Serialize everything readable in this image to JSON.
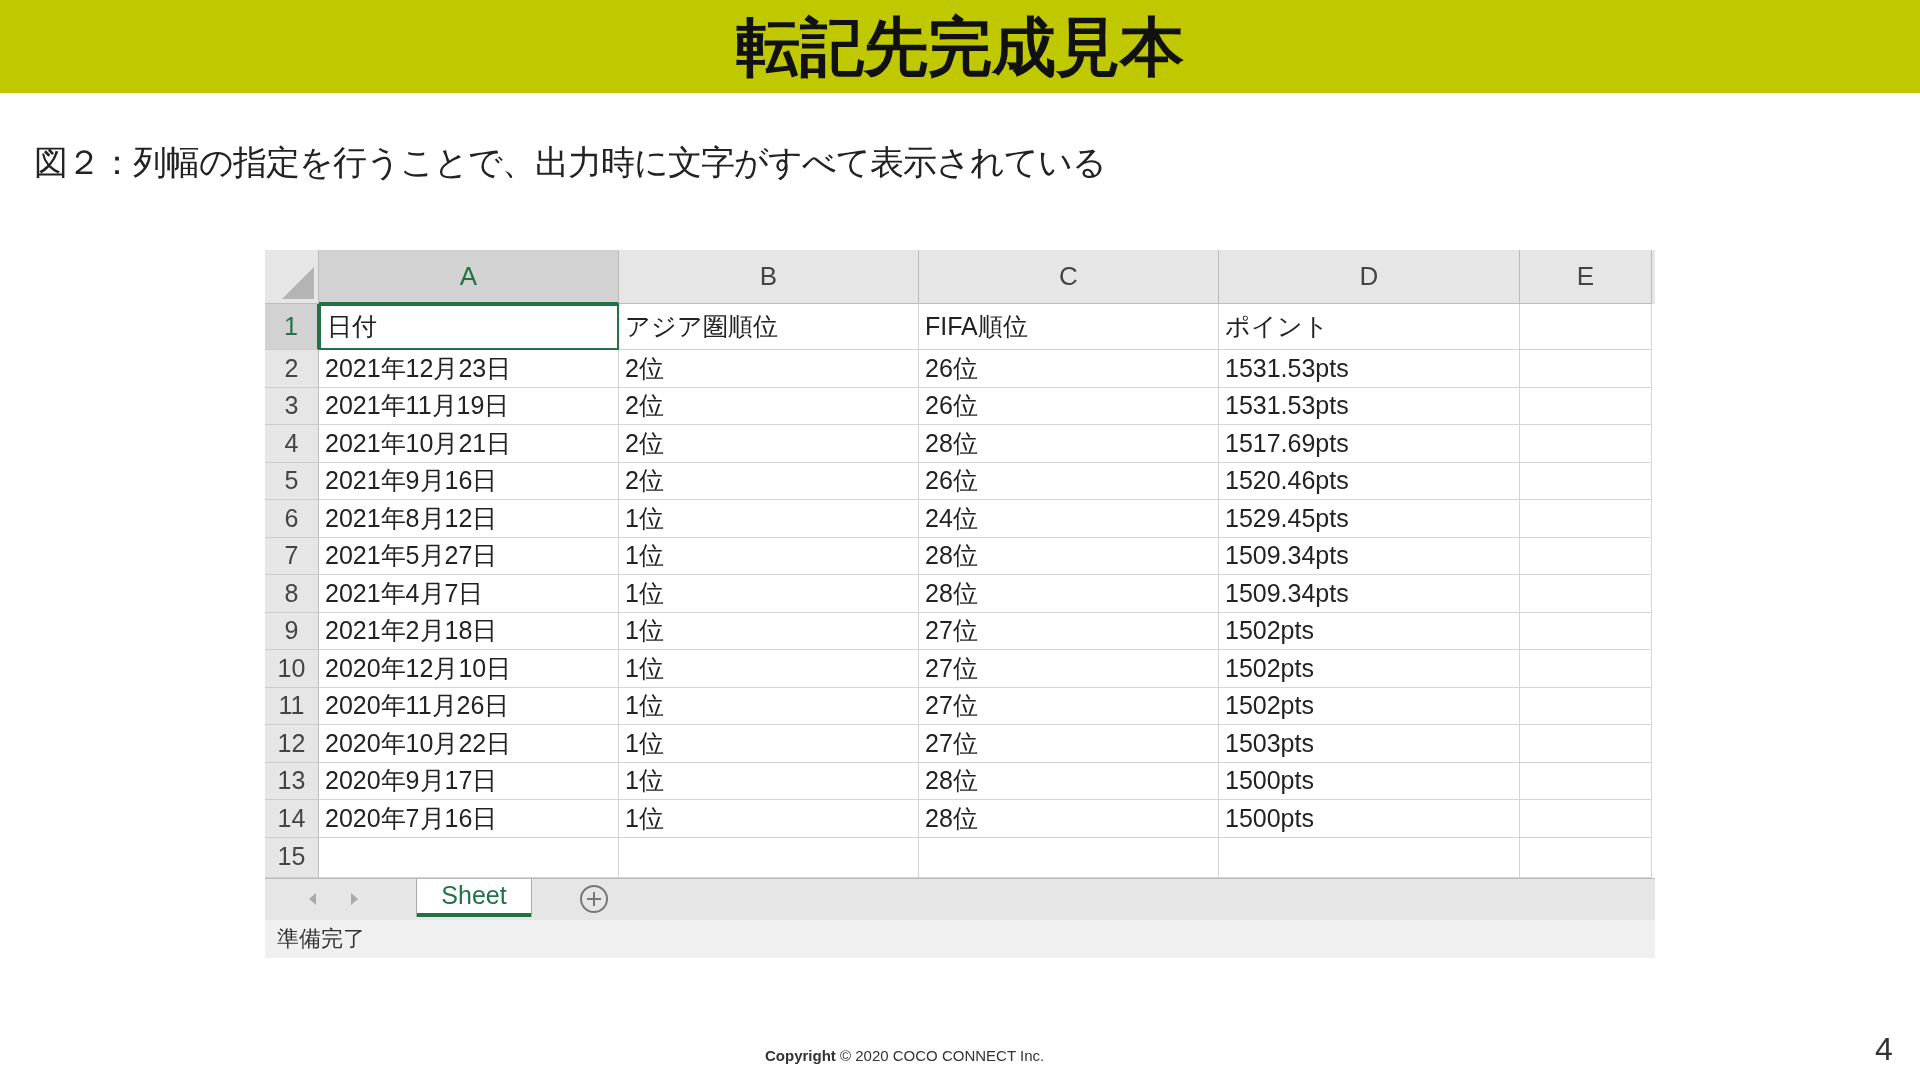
{
  "title": "転記先完成見本",
  "caption": "図２：列幅の指定を行うことで、出力時に文字がすべて表示されている",
  "sheet": {
    "columns": [
      {
        "label": "A",
        "selected": true
      },
      {
        "label": "B",
        "selected": false
      },
      {
        "label": "C",
        "selected": false
      },
      {
        "label": "D",
        "selected": false
      },
      {
        "label": "E",
        "selected": false
      }
    ],
    "rows": [
      {
        "number": "1",
        "selected": true,
        "cells": [
          "日付",
          "アジア圏順位",
          "FIFA順位",
          "ポイント"
        ]
      },
      {
        "number": "2",
        "selected": false,
        "cells": [
          "2021年12月23日",
          "2位",
          "26位",
          "1531.53pts"
        ]
      },
      {
        "number": "3",
        "selected": false,
        "cells": [
          "2021年11月19日",
          "2位",
          "26位",
          "1531.53pts"
        ]
      },
      {
        "number": "4",
        "selected": false,
        "cells": [
          "2021年10月21日",
          "2位",
          "28位",
          "1517.69pts"
        ]
      },
      {
        "number": "5",
        "selected": false,
        "cells": [
          "2021年9月16日",
          "2位",
          "26位",
          "1520.46pts"
        ]
      },
      {
        "number": "6",
        "selected": false,
        "cells": [
          "2021年8月12日",
          "1位",
          "24位",
          "1529.45pts"
        ]
      },
      {
        "number": "7",
        "selected": false,
        "cells": [
          "2021年5月27日",
          "1位",
          "28位",
          "1509.34pts"
        ]
      },
      {
        "number": "8",
        "selected": false,
        "cells": [
          "2021年4月7日",
          "1位",
          "28位",
          "1509.34pts"
        ]
      },
      {
        "number": "9",
        "selected": false,
        "cells": [
          "2021年2月18日",
          "1位",
          "27位",
          "1502pts"
        ]
      },
      {
        "number": "10",
        "selected": false,
        "cells": [
          "2020年12月10日",
          "1位",
          "27位",
          "1502pts"
        ]
      },
      {
        "number": "11",
        "selected": false,
        "cells": [
          "2020年11月26日",
          "1位",
          "27位",
          "1502pts"
        ]
      },
      {
        "number": "12",
        "selected": false,
        "cells": [
          "2020年10月22日",
          "1位",
          "27位",
          "1503pts"
        ]
      },
      {
        "number": "13",
        "selected": false,
        "cells": [
          "2020年9月17日",
          "1位",
          "28位",
          "1500pts"
        ]
      },
      {
        "number": "14",
        "selected": false,
        "cells": [
          "2020年7月16日",
          "1位",
          "28位",
          "1500pts"
        ]
      },
      {
        "number": "15",
        "selected": false,
        "cells": []
      }
    ],
    "tabs": [
      {
        "label": "Sheet",
        "selected": true
      }
    ],
    "status": "準備完了"
  },
  "copyright": "**Copyright** © 2020 COCO CONNECT Inc.",
  "page_number": "4"
}
